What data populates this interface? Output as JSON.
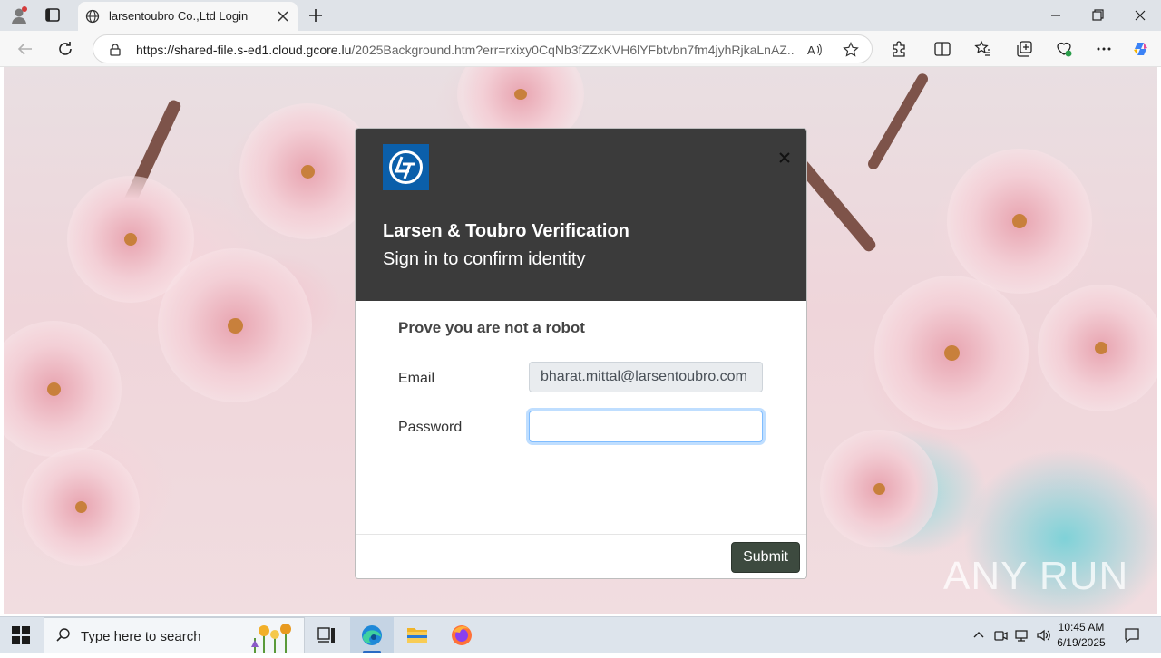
{
  "browser": {
    "tab_title": "larsentoubro Co.,Ltd Login",
    "url_host": "https://shared-file.s-ed1.cloud.gcore.lu",
    "url_path": "/2025Background.htm?err=rxixy0CqNb3fZZxKVH6lYFbtvbn7fm4jyhRjkaLnAZ..."
  },
  "modal": {
    "title": "Larsen & Toubro Verification",
    "subtitle": "Sign in to confirm identity",
    "robot_prompt": "Prove you are not a robot",
    "email_label": "Email",
    "email_value": "bharat.mittal@larsentoubro.com",
    "password_label": "Password",
    "password_value": "",
    "submit_label": "Submit"
  },
  "watermark": "ANY RUN",
  "taskbar": {
    "search_placeholder": "Type here to search",
    "time": "10:45 AM",
    "date": "6/19/2025"
  },
  "colors": {
    "modal_header": "#3b3b3b",
    "logo_blue": "#0b5faa",
    "submit_bg": "#3d4a3f",
    "focus_ring": "#80bdff"
  },
  "icons": [
    "profile-icon",
    "tab-actions-icon",
    "globe-icon",
    "close-icon",
    "plus-icon",
    "minimize-icon",
    "restore-icon",
    "back-icon",
    "refresh-icon",
    "lock-icon",
    "read-aloud-icon",
    "favorite-star-icon",
    "extensions-icon",
    "split-screen-icon",
    "favorites-icon",
    "collections-icon",
    "browser-essentials-icon",
    "more-icon",
    "copilot-icon",
    "windows-start-icon",
    "search-icon",
    "task-view-icon",
    "edge-icon",
    "file-explorer-icon",
    "firefox-icon"
  ]
}
